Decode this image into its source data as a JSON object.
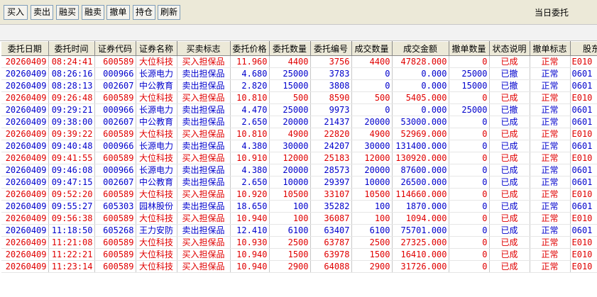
{
  "toolbar": {
    "buttons": [
      "买入",
      "卖出",
      "融买",
      "融卖",
      "撤单",
      "持仓",
      "刷新"
    ],
    "title": "当日委托"
  },
  "table": {
    "headers": [
      "委托日期",
      "委托时间",
      "证券代码",
      "证券名称",
      "买卖标志",
      "委托价格",
      "委托数量",
      "委托编号",
      "成交数量",
      "成交金额",
      "撤单数量",
      "状态说明",
      "撤单标志",
      "股东"
    ],
    "rows": [
      {
        "side": "buy",
        "cells": [
          "20260409",
          "08:24:41",
          "600589",
          "大位科技",
          "买入担保品",
          "11.960",
          "4400",
          "3756",
          "4400",
          "47828.000",
          "0",
          "已成",
          "正常",
          "E010"
        ]
      },
      {
        "side": "sell",
        "cells": [
          "20260409",
          "08:26:16",
          "000966",
          "长源电力",
          "卖出担保品",
          "4.680",
          "25000",
          "3783",
          "0",
          "0.000",
          "25000",
          "已撤",
          "正常",
          "0601"
        ]
      },
      {
        "side": "sell",
        "cells": [
          "20260409",
          "08:28:13",
          "002607",
          "中公教育",
          "卖出担保品",
          "2.820",
          "15000",
          "3808",
          "0",
          "0.000",
          "15000",
          "已撤",
          "正常",
          "0601"
        ]
      },
      {
        "side": "buy",
        "cells": [
          "20260409",
          "09:26:48",
          "600589",
          "大位科技",
          "买入担保品",
          "10.810",
          "500",
          "8590",
          "500",
          "5405.000",
          "0",
          "已成",
          "正常",
          "E010"
        ]
      },
      {
        "side": "sell",
        "cells": [
          "20260409",
          "09:29:21",
          "000966",
          "长源电力",
          "卖出担保品",
          "4.470",
          "25000",
          "9973",
          "0",
          "0.000",
          "25000",
          "已撤",
          "正常",
          "0601"
        ]
      },
      {
        "side": "sell",
        "cells": [
          "20260409",
          "09:38:00",
          "002607",
          "中公教育",
          "卖出担保品",
          "2.650",
          "20000",
          "21437",
          "20000",
          "53000.000",
          "0",
          "已成",
          "正常",
          "0601"
        ]
      },
      {
        "side": "buy",
        "cells": [
          "20260409",
          "09:39:22",
          "600589",
          "大位科技",
          "买入担保品",
          "10.810",
          "4900",
          "22820",
          "4900",
          "52969.000",
          "0",
          "已成",
          "正常",
          "E010"
        ]
      },
      {
        "side": "sell",
        "cells": [
          "20260409",
          "09:40:48",
          "000966",
          "长源电力",
          "卖出担保品",
          "4.380",
          "30000",
          "24207",
          "30000",
          "131400.000",
          "0",
          "已成",
          "正常",
          "0601"
        ]
      },
      {
        "side": "buy",
        "cells": [
          "20260409",
          "09:41:55",
          "600589",
          "大位科技",
          "买入担保品",
          "10.910",
          "12000",
          "25183",
          "12000",
          "130920.000",
          "0",
          "已成",
          "正常",
          "E010"
        ]
      },
      {
        "side": "sell",
        "cells": [
          "20260409",
          "09:46:08",
          "000966",
          "长源电力",
          "卖出担保品",
          "4.380",
          "20000",
          "28573",
          "20000",
          "87600.000",
          "0",
          "已成",
          "正常",
          "0601"
        ]
      },
      {
        "side": "sell",
        "cells": [
          "20260409",
          "09:47:15",
          "002607",
          "中公教育",
          "卖出担保品",
          "2.650",
          "10000",
          "29397",
          "10000",
          "26500.000",
          "0",
          "已成",
          "正常",
          "0601"
        ]
      },
      {
        "side": "buy",
        "cells": [
          "20260409",
          "09:52:20",
          "600589",
          "大位科技",
          "买入担保品",
          "10.920",
          "10500",
          "33107",
          "10500",
          "114660.000",
          "0",
          "已成",
          "正常",
          "E010"
        ]
      },
      {
        "side": "sell",
        "cells": [
          "20260409",
          "09:55:27",
          "605303",
          "园林股份",
          "卖出担保品",
          "18.650",
          "100",
          "35282",
          "100",
          "1870.000",
          "0",
          "已成",
          "正常",
          "0601"
        ]
      },
      {
        "side": "buy",
        "cells": [
          "20260409",
          "09:56:38",
          "600589",
          "大位科技",
          "买入担保品",
          "10.940",
          "100",
          "36087",
          "100",
          "1094.000",
          "0",
          "已成",
          "正常",
          "E010"
        ]
      },
      {
        "side": "sell",
        "cells": [
          "20260409",
          "11:18:50",
          "605268",
          "王力安防",
          "卖出担保品",
          "12.410",
          "6100",
          "63407",
          "6100",
          "75701.000",
          "0",
          "已成",
          "正常",
          "0601"
        ]
      },
      {
        "side": "buy",
        "cells": [
          "20260409",
          "11:21:08",
          "600589",
          "大位科技",
          "买入担保品",
          "10.930",
          "2500",
          "63787",
          "2500",
          "27325.000",
          "0",
          "已成",
          "正常",
          "E010"
        ]
      },
      {
        "side": "buy",
        "cells": [
          "20260409",
          "11:22:21",
          "600589",
          "大位科技",
          "买入担保品",
          "10.940",
          "1500",
          "63978",
          "1500",
          "16410.000",
          "0",
          "已成",
          "正常",
          "E010"
        ]
      },
      {
        "side": "buy",
        "cells": [
          "20260409",
          "11:23:14",
          "600589",
          "大位科技",
          "买入担保品",
          "10.940",
          "2900",
          "64088",
          "2900",
          "31726.000",
          "0",
          "已成",
          "正常",
          "E010"
        ]
      }
    ]
  }
}
